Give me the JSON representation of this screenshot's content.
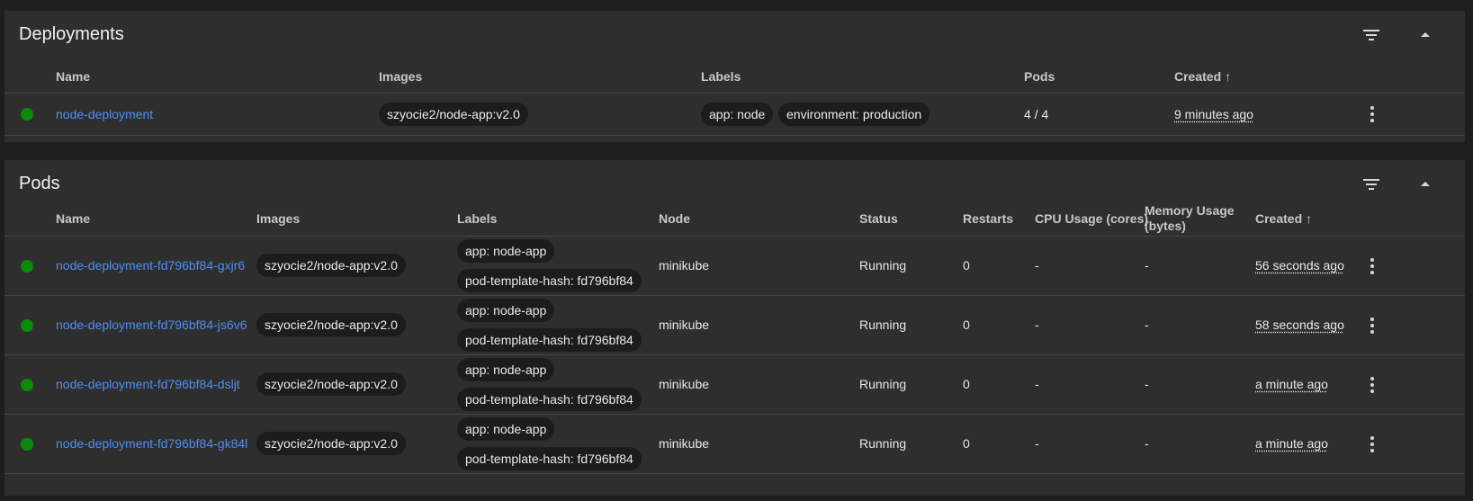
{
  "colors": {
    "status_ok": "#0b8a0b",
    "link": "#4f8ef2",
    "card_bg": "#2e2e2e",
    "page_bg": "#1e1e1e"
  },
  "deployments": {
    "title": "Deployments",
    "filter_icon": "filter-icon",
    "collapse_icon": "chevron-up-icon",
    "columns": {
      "name": "Name",
      "images": "Images",
      "labels": "Labels",
      "pods": "Pods",
      "created": "Created",
      "sort_arrow": "↑"
    },
    "rows": [
      {
        "status": "running",
        "name": "node-deployment",
        "image": "szyocie2/node-app:v2.0",
        "labels": [
          "app: node",
          "environment: production"
        ],
        "pods": "4 / 4",
        "created": "9 minutes ago"
      }
    ]
  },
  "pods": {
    "title": "Pods",
    "filter_icon": "filter-icon",
    "collapse_icon": "chevron-up-icon",
    "columns": {
      "name": "Name",
      "images": "Images",
      "labels": "Labels",
      "node": "Node",
      "status": "Status",
      "restarts": "Restarts",
      "cpu": "CPU Usage (cores)",
      "memory_line1": "Memory Usage",
      "memory_line2": "(bytes)",
      "created": "Created",
      "sort_arrow": "↑"
    },
    "rows": [
      {
        "name": "node-deployment-fd796bf84-gxjr6",
        "image": "szyocie2/node-app:v2.0",
        "labels": [
          "app: node-app",
          "pod-template-hash: fd796bf84"
        ],
        "node": "minikube",
        "status": "Running",
        "restarts": "0",
        "cpu": "-",
        "memory": "-",
        "created": "56 seconds ago"
      },
      {
        "name": "node-deployment-fd796bf84-js6v6",
        "image": "szyocie2/node-app:v2.0",
        "labels": [
          "app: node-app",
          "pod-template-hash: fd796bf84"
        ],
        "node": "minikube",
        "status": "Running",
        "restarts": "0",
        "cpu": "-",
        "memory": "-",
        "created": "58 seconds ago"
      },
      {
        "name": "node-deployment-fd796bf84-dsljt",
        "image": "szyocie2/node-app:v2.0",
        "labels": [
          "app: node-app",
          "pod-template-hash: fd796bf84"
        ],
        "node": "minikube",
        "status": "Running",
        "restarts": "0",
        "cpu": "-",
        "memory": "-",
        "created": "a minute ago"
      },
      {
        "name": "node-deployment-fd796bf84-gk84l",
        "image": "szyocie2/node-app:v2.0",
        "labels": [
          "app: node-app",
          "pod-template-hash: fd796bf84"
        ],
        "node": "minikube",
        "status": "Running",
        "restarts": "0",
        "cpu": "-",
        "memory": "-",
        "created": "a minute ago"
      }
    ]
  }
}
